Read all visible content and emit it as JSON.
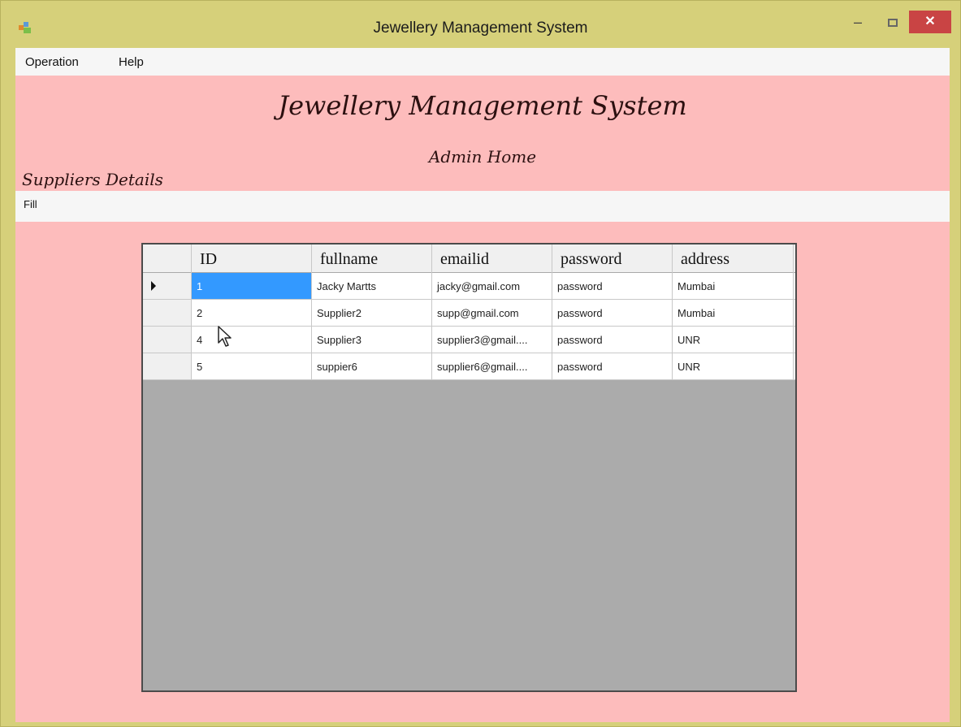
{
  "window": {
    "title": "Jewellery Management System",
    "minimize_label": "–",
    "close_label": "✕"
  },
  "menu": {
    "items": [
      "Operation",
      "Help"
    ]
  },
  "header": {
    "title": "Jewellery Management System",
    "subtitle": "Admin Home",
    "section": "Suppliers Details"
  },
  "toolbar": {
    "fill_label": "Fill"
  },
  "table": {
    "columns": [
      "ID",
      "fullname",
      "emailid",
      "password",
      "address"
    ],
    "rows": [
      {
        "id": "1",
        "fullname": "Jacky Martts",
        "emailid": "jacky@gmail.com",
        "password": "password",
        "address": "Mumbai"
      },
      {
        "id": "2",
        "fullname": "Supplier2",
        "emailid": "supp@gmail.com",
        "password": "password",
        "address": "Mumbai"
      },
      {
        "id": "4",
        "fullname": "Supplier3",
        "emailid": "supplier3@gmail....",
        "password": "password",
        "address": "UNR"
      },
      {
        "id": "5",
        "fullname": "suppier6",
        "emailid": "supplier6@gmail....",
        "password": "password",
        "address": "UNR"
      }
    ]
  },
  "colors": {
    "window_frame": "#d6d07a",
    "client_background": "#fdbcbc",
    "grid_background": "#ababab",
    "selection": "#3399ff",
    "close_button": "#c94444"
  },
  "icons": [
    "app-icon",
    "minimize-icon",
    "maximize-icon",
    "close-icon",
    "current-row-icon",
    "mouse-cursor-icon"
  ]
}
